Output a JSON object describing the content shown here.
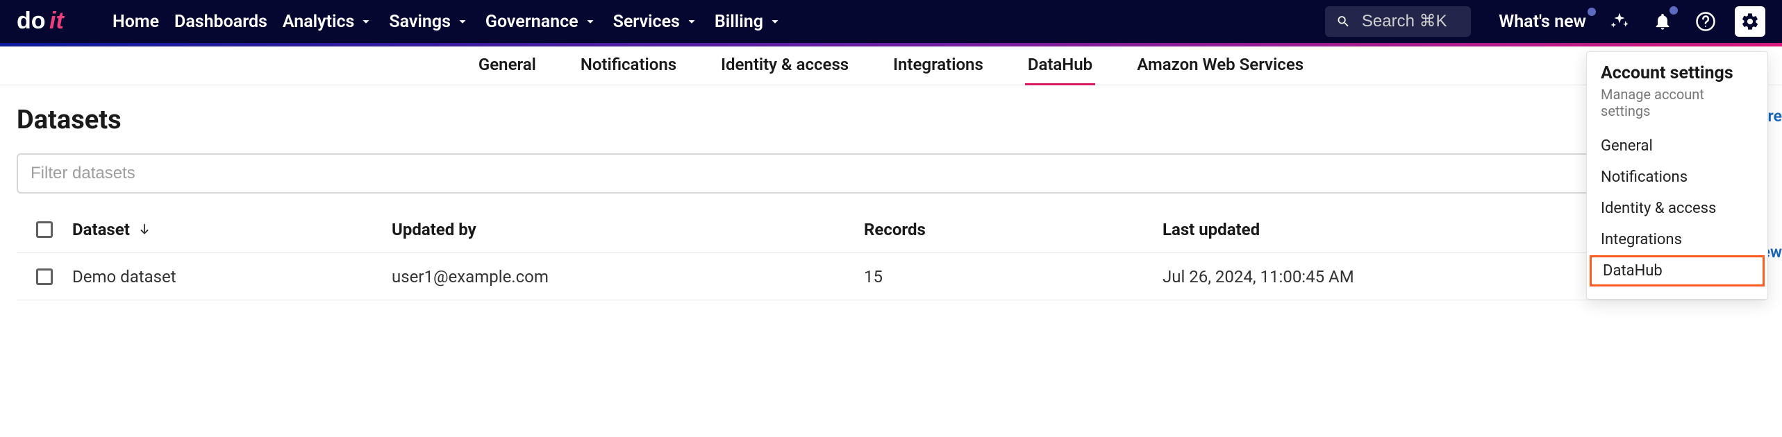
{
  "nav": {
    "brand": "doit",
    "links": [
      {
        "label": "Home",
        "has_chevron": false
      },
      {
        "label": "Dashboards",
        "has_chevron": false
      },
      {
        "label": "Analytics",
        "has_chevron": true
      },
      {
        "label": "Savings",
        "has_chevron": true
      },
      {
        "label": "Governance",
        "has_chevron": true
      },
      {
        "label": "Services",
        "has_chevron": true
      },
      {
        "label": "Billing",
        "has_chevron": true
      }
    ],
    "search_placeholder": "Search ⌘K",
    "whats_new_label": "What's new"
  },
  "tabs": [
    {
      "label": "General",
      "active": false
    },
    {
      "label": "Notifications",
      "active": false
    },
    {
      "label": "Identity & access",
      "active": false
    },
    {
      "label": "Integrations",
      "active": false
    },
    {
      "label": "DataHub",
      "active": true
    },
    {
      "label": "Amazon Web Services",
      "active": false
    }
  ],
  "page": {
    "title": "Datasets",
    "filter_placeholder": "Filter datasets"
  },
  "columns": {
    "dataset": "Dataset",
    "updated_by": "Updated by",
    "records": "Records",
    "last_updated": "Last updated"
  },
  "rows": [
    {
      "dataset": "Demo dataset",
      "updated_by": "user1@example.com",
      "records": "15",
      "last_updated": "Jul 26, 2024, 11:00:45 AM"
    }
  ],
  "popover": {
    "title": "Account settings",
    "subtitle": "Manage account settings",
    "items": [
      {
        "label": "General",
        "highlight": false
      },
      {
        "label": "Notifications",
        "highlight": false
      },
      {
        "label": "Identity & access",
        "highlight": false
      },
      {
        "label": "Integrations",
        "highlight": false
      },
      {
        "label": "DataHub",
        "highlight": true
      }
    ]
  },
  "partial_right": {
    "r1": "Cre",
    "r2": "ew"
  }
}
